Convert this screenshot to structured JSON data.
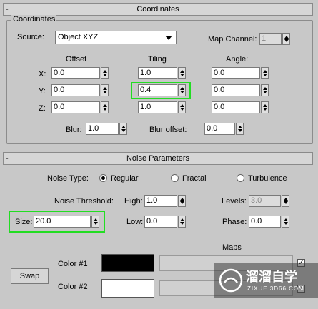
{
  "coordinates": {
    "header_symbol": "-",
    "header": "Coordinates",
    "group_title": "Coordinates",
    "source_label": "Source:",
    "source_value": "Object XYZ",
    "map_channel_label": "Map Channel:",
    "map_channel_value": "1",
    "col_offset": "Offset",
    "col_tiling": "Tiling",
    "col_angle": "Angle:",
    "axis_x": "X:",
    "axis_y": "Y:",
    "axis_z": "Z:",
    "offset": [
      "0.0",
      "0.0",
      "0.0"
    ],
    "tiling": [
      "1.0",
      "0.4",
      "1.0"
    ],
    "angle": [
      "0.0",
      "0.0",
      "0.0"
    ],
    "blur_label": "Blur:",
    "blur_value": "1.0",
    "blur_offset_label": "Blur offset:",
    "blur_offset_value": "0.0"
  },
  "noise": {
    "header_symbol": "-",
    "header": "Noise Parameters",
    "noise_type_label": "Noise Type:",
    "type_regular": "Regular",
    "type_fractal": "Fractal",
    "type_turbulence": "Turbulence",
    "selected_type": "Regular",
    "threshold_label": "Noise Threshold:",
    "high_label": "High:",
    "high_value": "1.0",
    "levels_label": "Levels:",
    "levels_value": "3.0",
    "size_label": "Size:",
    "size_value": "20.0",
    "low_label": "Low:",
    "low_value": "0.0",
    "phase_label": "Phase:",
    "phase_value": "0.0",
    "maps_label": "Maps",
    "swap_label": "Swap",
    "color1_label": "Color #1",
    "color2_label": "Color #2",
    "color1": "#000000",
    "color2": "#ffffff",
    "map1_checked": true,
    "map2_checked": true,
    "check_glyph": "✓"
  },
  "watermark": {
    "cn": "溜溜自学",
    "url": "ZIXUE.3D66.COM"
  },
  "colors": {
    "highlight": "#22dd22",
    "panel": "#c8c8c8"
  }
}
